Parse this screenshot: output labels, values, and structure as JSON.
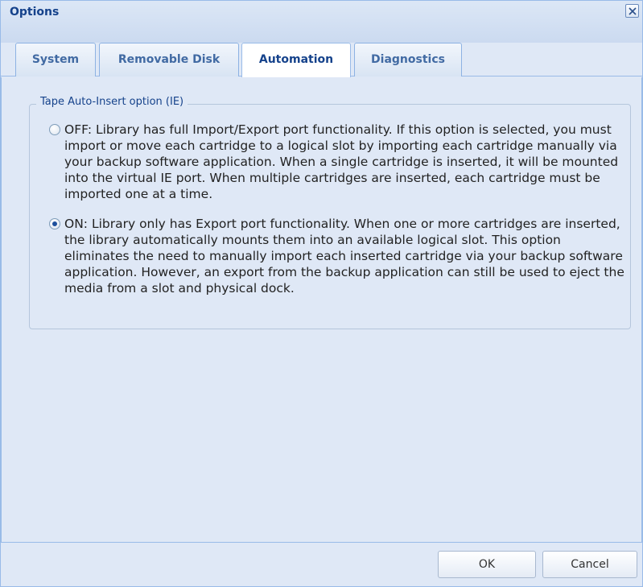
{
  "window": {
    "title": "Options",
    "close_icon": "close-icon"
  },
  "tabs": [
    {
      "label": "System",
      "active": false
    },
    {
      "label": "Removable Disk",
      "active": false
    },
    {
      "label": "Automation",
      "active": true
    },
    {
      "label": "Diagnostics",
      "active": false
    }
  ],
  "fieldset": {
    "legend": "Tape Auto-Insert option (IE)",
    "options": [
      {
        "label": "OFF: Library has full Import/Export port functionality. If this option is selected, you must import or move each cartridge to a logical slot by importing each cartridge manually via your backup software application. When a single cartridge is inserted, it will be mounted into the virtual IE port. When multiple cartridges are inserted, each cartridge must be imported one at a time.",
        "selected": false
      },
      {
        "label": "ON: Library only has Export port functionality. When one or more cartridges are inserted, the library automatically mounts them into an available logical slot. This option eliminates the need to manually import each inserted cartridge via your backup software application. However, an export from the backup application can still be used to eject the media from a slot and physical dock.",
        "selected": true
      }
    ]
  },
  "buttons": {
    "ok": "OK",
    "cancel": "Cancel"
  },
  "colors": {
    "title_text": "#15428b",
    "panel_bg": "#dfe8f6",
    "border": "#99bbe8"
  }
}
